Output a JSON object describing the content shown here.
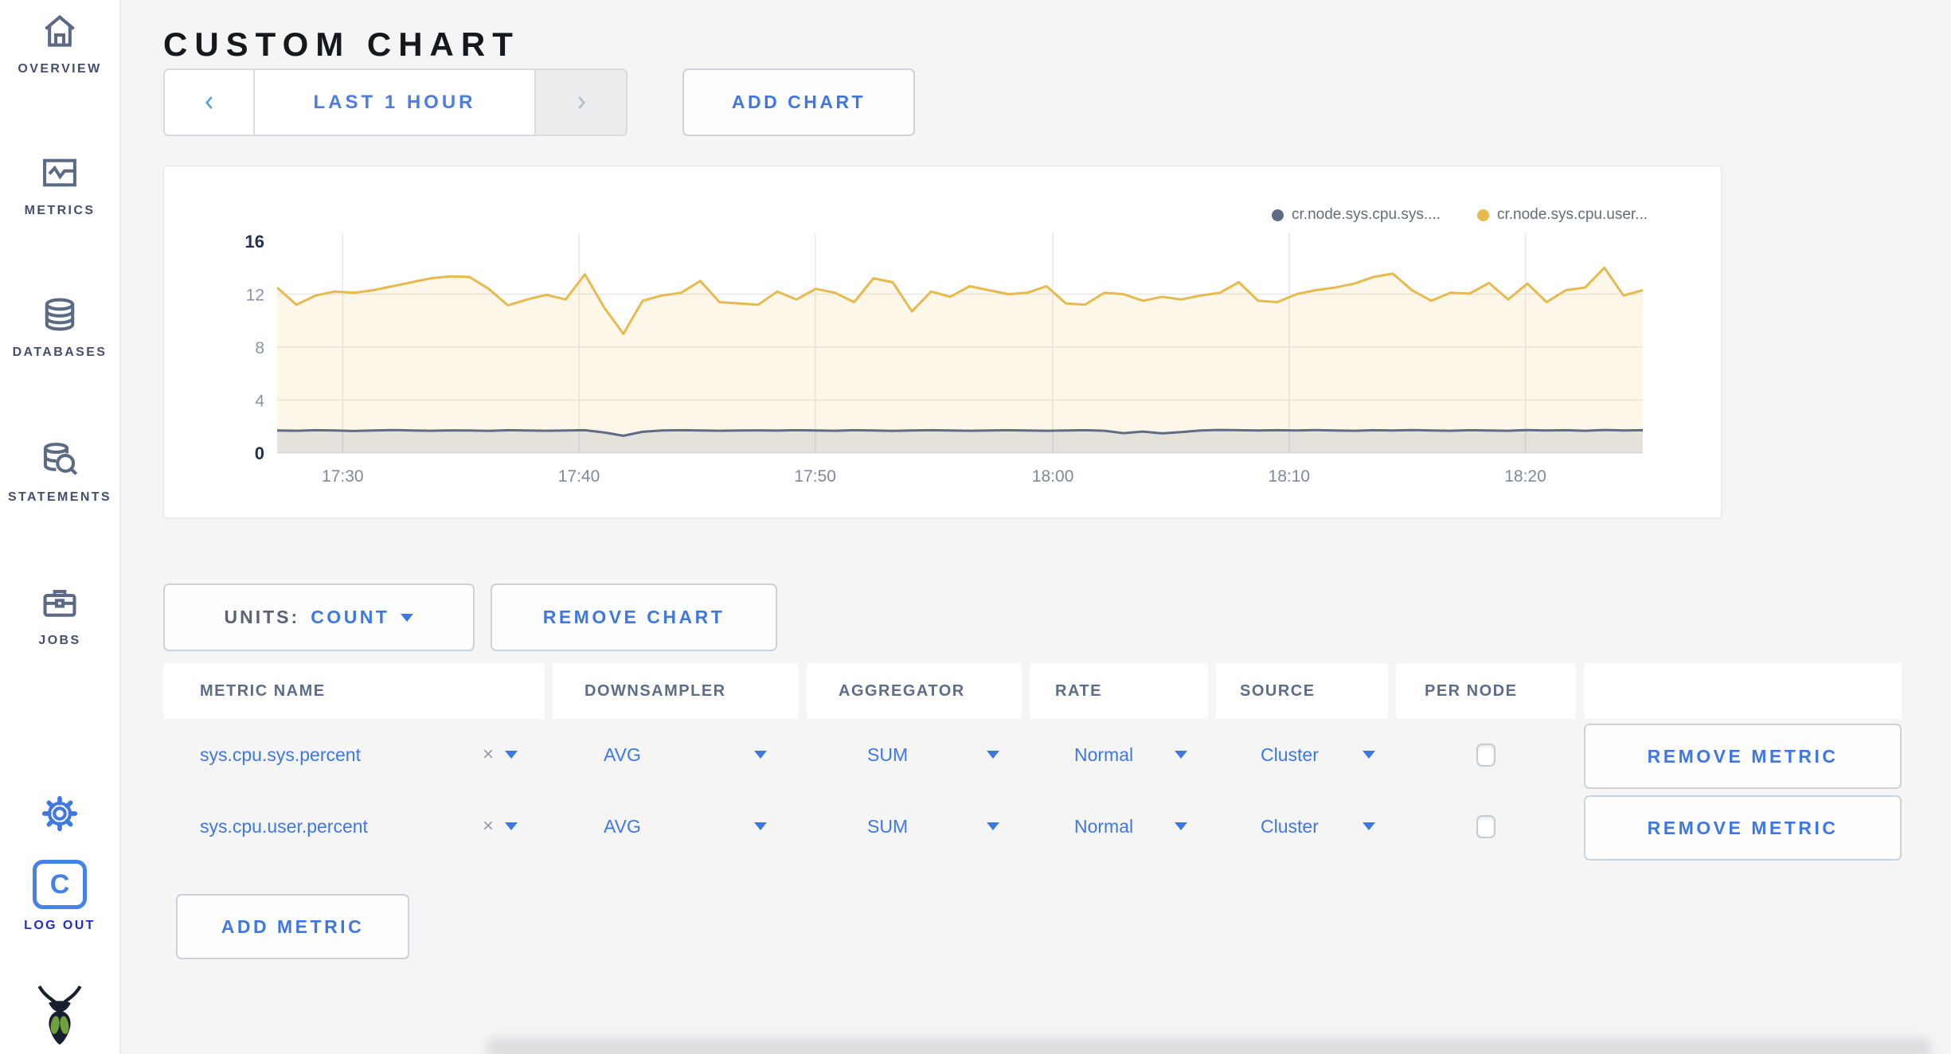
{
  "colors": {
    "accent_blue": "#3e78e0",
    "logout_blue": "#1f2cd0",
    "sidebar_slate": "#5b6a85",
    "page_bg": "#f5f5f6",
    "series_sys": "#5f6c87",
    "series_user": "#e8ba4e"
  },
  "sidebar": {
    "items": [
      {
        "label": "OVERVIEW",
        "icon": "home-icon"
      },
      {
        "label": "METRICS",
        "icon": "metrics-graph-icon"
      },
      {
        "label": "DATABASES",
        "icon": "database-icon"
      },
      {
        "label": "STATEMENTS",
        "icon": "statements-search-icon"
      },
      {
        "label": "JOBS",
        "icon": "jobs-briefcase-icon"
      }
    ],
    "settings_icon": "gear-icon",
    "logout": {
      "label": "LOG OUT",
      "icon": "cockroach-c-icon"
    },
    "brand_icon": "cockroachdb-bug-logo"
  },
  "header": {
    "title": "CUSTOM CHART"
  },
  "toolbar": {
    "time_range_label": "LAST 1 HOUR",
    "prev_icon": "chevron-left-icon",
    "next_icon": "chevron-right-icon",
    "add_chart_label": "ADD CHART"
  },
  "chart_data": {
    "type": "area",
    "title": "",
    "ylim": [
      0,
      16
    ],
    "y_ticks": [
      0,
      4,
      8,
      12,
      16
    ],
    "x_tick_labels": [
      "17:30",
      "17:40",
      "17:50",
      "18:00",
      "18:10",
      "18:20"
    ],
    "x_tick_fracs": [
      0.048,
      0.221,
      0.394,
      0.568,
      0.741,
      0.914
    ],
    "grid": true,
    "legend_position": "top-right",
    "series": [
      {
        "name": "cr.node.sys.cpu.sys....",
        "color": "#5f6c87",
        "fill": "rgba(95,108,135,0.15)",
        "values": [
          1.7,
          1.68,
          1.72,
          1.7,
          1.66,
          1.7,
          1.73,
          1.7,
          1.68,
          1.71,
          1.7,
          1.67,
          1.72,
          1.7,
          1.68,
          1.7,
          1.72,
          1.55,
          1.3,
          1.6,
          1.7,
          1.72,
          1.7,
          1.68,
          1.7,
          1.71,
          1.69,
          1.72,
          1.7,
          1.68,
          1.72,
          1.7,
          1.67,
          1.7,
          1.72,
          1.7,
          1.68,
          1.7,
          1.72,
          1.7,
          1.68,
          1.7,
          1.72,
          1.68,
          1.5,
          1.62,
          1.48,
          1.58,
          1.7,
          1.74,
          1.72,
          1.7,
          1.72,
          1.7,
          1.73,
          1.7,
          1.68,
          1.72,
          1.7,
          1.73,
          1.7,
          1.68,
          1.72,
          1.7,
          1.68,
          1.73,
          1.7,
          1.72,
          1.68,
          1.74,
          1.7,
          1.72
        ]
      },
      {
        "name": "cr.node.sys.cpu.user...",
        "color": "#e8ba4e",
        "fill": "rgba(232,186,78,0.12)",
        "values": [
          12.5,
          11.2,
          11.9,
          12.2,
          12.1,
          12.3,
          12.6,
          12.9,
          13.2,
          13.35,
          13.3,
          12.4,
          11.15,
          11.6,
          11.95,
          11.6,
          13.5,
          11.0,
          9.0,
          11.5,
          11.9,
          12.1,
          13.0,
          11.4,
          11.3,
          11.2,
          12.2,
          11.6,
          12.4,
          12.1,
          11.4,
          13.2,
          12.9,
          10.7,
          12.2,
          11.8,
          12.6,
          12.3,
          12.0,
          12.1,
          12.6,
          11.3,
          11.2,
          12.1,
          12.0,
          11.5,
          11.8,
          11.6,
          11.9,
          12.1,
          12.9,
          11.5,
          11.4,
          12.0,
          12.3,
          12.5,
          12.8,
          13.3,
          13.55,
          12.3,
          11.5,
          12.1,
          12.05,
          12.85,
          11.6,
          12.8,
          11.4,
          12.3,
          12.5,
          14.0,
          11.9,
          12.3
        ]
      }
    ]
  },
  "chart_controls": {
    "units_label": "UNITS:",
    "units_value": "COUNT",
    "remove_chart_label": "REMOVE CHART",
    "add_metric_label": "ADD METRIC"
  },
  "metrics_table": {
    "columns": [
      "METRIC NAME",
      "DOWNSAMPLER",
      "AGGREGATOR",
      "RATE",
      "SOURCE",
      "PER NODE",
      ""
    ],
    "clear_glyph": "×",
    "rows": [
      {
        "metric_name": "sys.cpu.sys.percent",
        "downsampler": "AVG",
        "aggregator": "SUM",
        "rate": "Normal",
        "source": "Cluster",
        "per_node_checked": false,
        "remove_label": "REMOVE METRIC"
      },
      {
        "metric_name": "sys.cpu.user.percent",
        "downsampler": "AVG",
        "aggregator": "SUM",
        "rate": "Normal",
        "source": "Cluster",
        "per_node_checked": false,
        "remove_label": "REMOVE METRIC"
      }
    ]
  }
}
